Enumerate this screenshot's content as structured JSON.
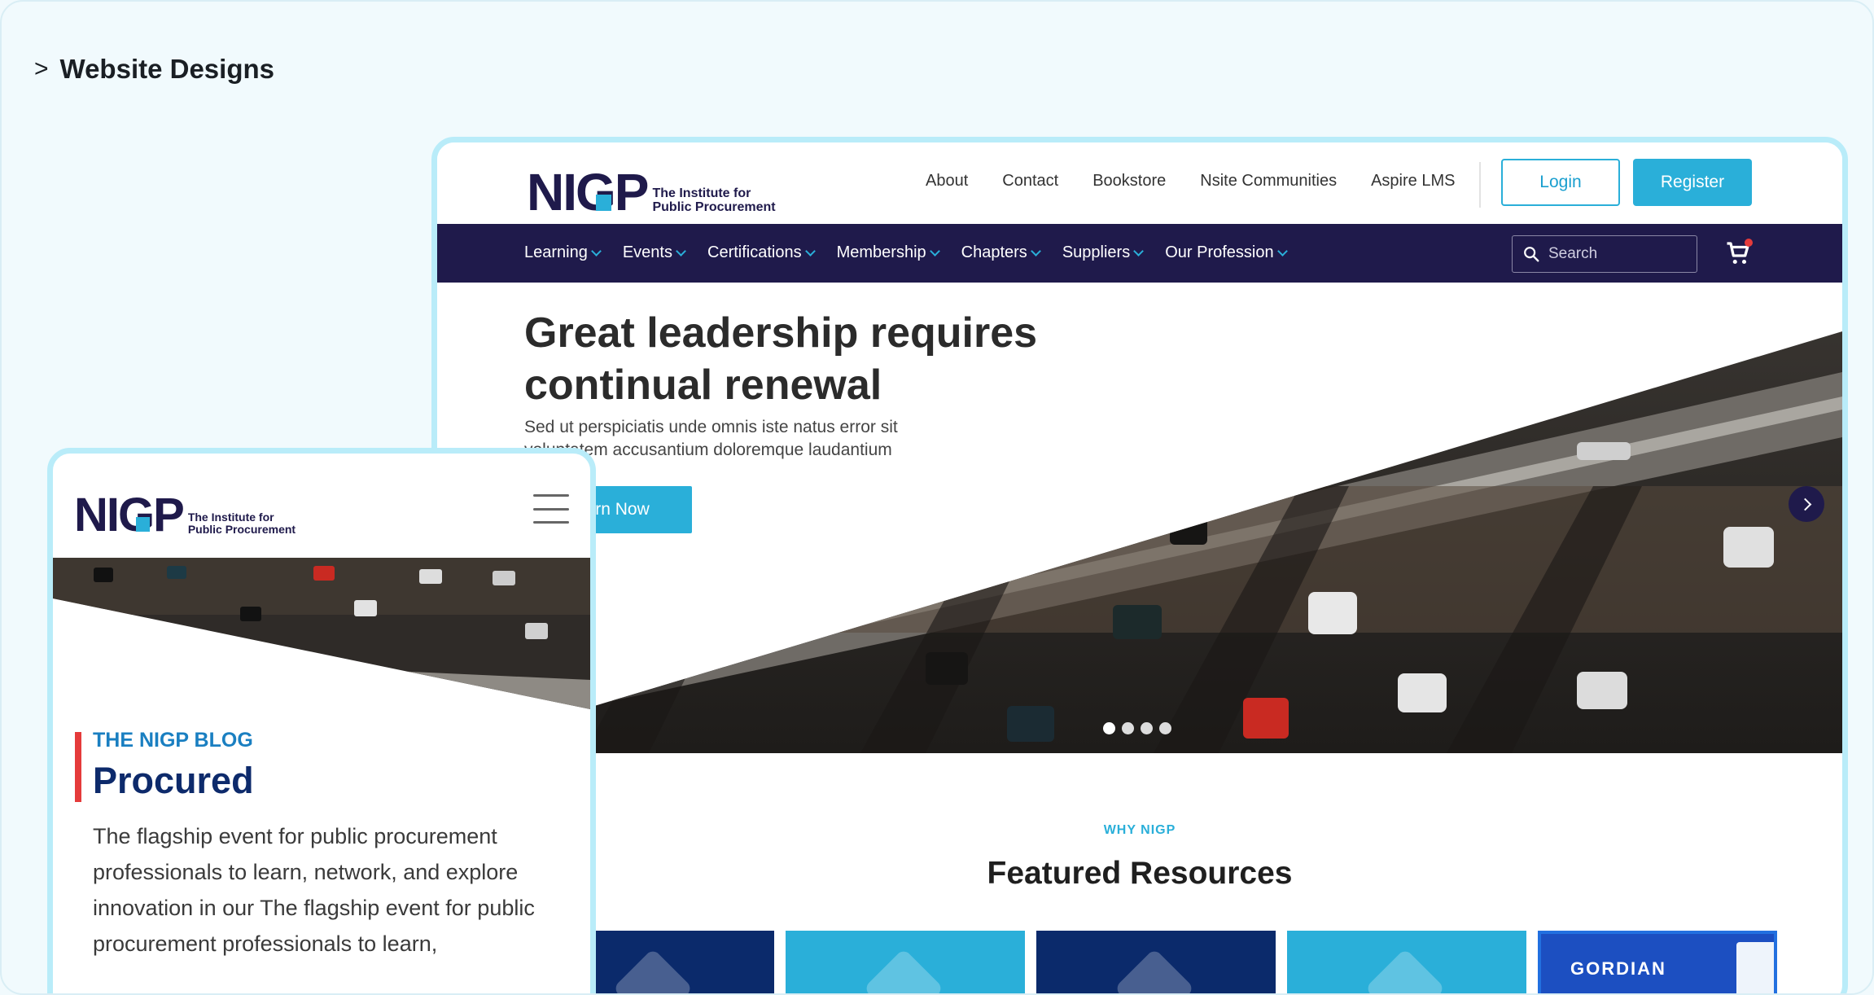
{
  "section_heading": {
    "chevron": ">",
    "text": "Website Designs"
  },
  "brand": {
    "name": "NIGP",
    "tagline_line1": "The Institute for",
    "tagline_line2": "Public Procurement",
    "colors": {
      "navy": "#1f1a4b",
      "accent": "#2aafd9",
      "alert": "#e53b3b"
    }
  },
  "desktop": {
    "top_links": [
      "About",
      "Contact",
      "Bookstore",
      "Nsite Communities",
      "Aspire LMS"
    ],
    "login_label": "Login",
    "register_label": "Register",
    "nav": [
      "Learning",
      "Events",
      "Certifications",
      "Membership",
      "Chapters",
      "Suppliers",
      "Our Profession"
    ],
    "search_placeholder": "Search",
    "hero": {
      "title": "Great leadership requires continual renewal",
      "subtitle": "Sed ut perspiciatis unde omnis iste natus error sit voluptatem accusantium doloremque laudantium",
      "button_label": "Learn Now",
      "slides": 4,
      "active_slide": 1
    },
    "eyebrow": "WHY NIGP",
    "featured_title": "Featured Resources",
    "cards": [
      {
        "style": "dark",
        "icon": "book-icon"
      },
      {
        "style": "light",
        "icon": "question-bubble-icon"
      },
      {
        "style": "dark",
        "icon": "question-box-icon"
      },
      {
        "style": "light",
        "icon": "presentation-icon"
      },
      {
        "style": "gordian",
        "label": "GORDIAN"
      }
    ]
  },
  "mobile": {
    "eyebrow": "THE NIGP BLOG",
    "title": "Procured",
    "body": "The flagship event for public procurement professionals to learn, network, and explore innovation in our The flagship event for public procurement professionals to learn,"
  }
}
